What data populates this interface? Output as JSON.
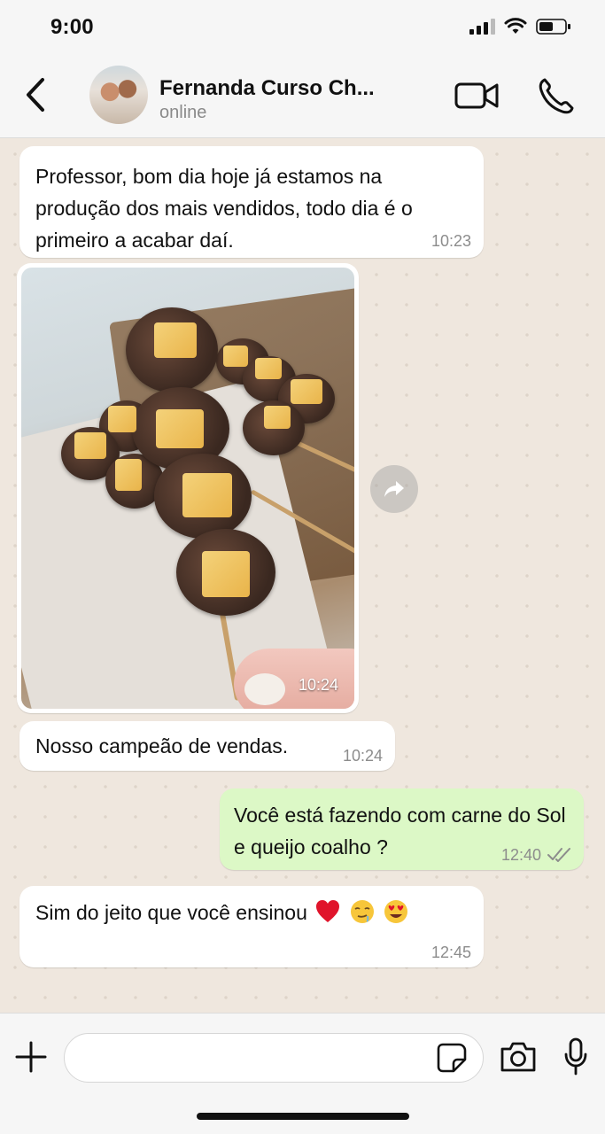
{
  "status_bar": {
    "time": "9:00"
  },
  "header": {
    "contact_name": "Fernanda Curso Ch...",
    "contact_status": "online"
  },
  "messages": [
    {
      "direction": "incoming",
      "text": "Professor, bom dia hoje já estamos na produção dos mais vendidos, todo dia é o primeiro a acabar daí.",
      "time": "10:23"
    },
    {
      "direction": "incoming",
      "type": "image",
      "image_alt": "Espetinhos de carne recheados com queijo coalho",
      "time": "10:24"
    },
    {
      "direction": "incoming",
      "text": "Nosso campeão de vendas.",
      "time": "10:24"
    },
    {
      "direction": "outgoing",
      "text": "Você está fazendo com carne do Sol e queijo coalho ?",
      "time": "12:40",
      "read": true
    },
    {
      "direction": "incoming",
      "text": "Sim do jeito que você ensinou",
      "emojis": [
        "red-heart",
        "relieved-face-with-drool",
        "heart-eyes"
      ],
      "time": "12:45"
    }
  ],
  "input": {
    "placeholder": ""
  },
  "colors": {
    "incoming_bubble": "#ffffff",
    "outgoing_bubble": "#dcf8c6",
    "chat_bg": "#efe7de",
    "read_ticks": "#8c8c8c"
  }
}
